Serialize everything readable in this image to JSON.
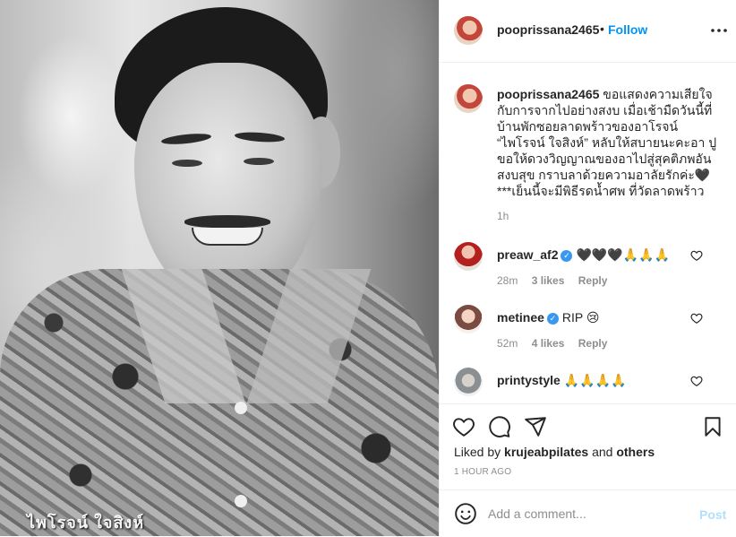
{
  "photo": {
    "caption": "ไพโรจน์ ใจสิงห์"
  },
  "header": {
    "username": "pooprissana2465",
    "separator": "•",
    "follow_label": "Follow",
    "more_label": "•••"
  },
  "caption": {
    "username": "pooprissana2465",
    "text": "ขอแสดงความเสียใจกับการจากไปอย่างสงบ เมื่อเช้ามืดวันนี้ที่บ้านพักซอยลาดพร้าวของอาโรจน์ “ไพโรจน์ ใจสิงห์” หลับให้สบายนะคะอา ปูขอให้ดวงวิญญาณของอาไปสู่สุคติภพอันสงบสุข กราบลาด้วยความอาลัยรักค่ะ🖤 ***เย็นนี้จะมีพิธีรดน้ำศพ ที่วัดลาดพร้าว",
    "time": "1h"
  },
  "comments": [
    {
      "username": "preaw_af2",
      "verified": true,
      "text": "🖤🖤🖤🙏🙏🙏",
      "time": "28m",
      "likes": "3 likes",
      "reply": "Reply"
    },
    {
      "username": "metinee",
      "verified": true,
      "text": "RIP 😢",
      "time": "52m",
      "likes": "4 likes",
      "reply": "Reply"
    },
    {
      "username": "printystyle",
      "verified": false,
      "text": "🙏🙏🙏🙏",
      "time": "",
      "likes": "",
      "reply": ""
    }
  ],
  "footer": {
    "liked_by_prefix": "Liked by",
    "liked_by_user": "krujeabpilates",
    "liked_by_suffix": "and",
    "liked_by_others": "others",
    "post_age": "1 HOUR AGO",
    "comment_placeholder": "Add a comment...",
    "post_label": "Post"
  },
  "icons": {
    "like": "heart-icon",
    "comment": "comment-icon",
    "share": "share-icon",
    "save": "bookmark-icon",
    "emoji": "emoji-icon",
    "more": "more-icon"
  },
  "colors": {
    "link": "#0095f6",
    "post_disabled": "#b2dffc",
    "muted": "#8e8e8e",
    "verified": "#3897f0"
  }
}
